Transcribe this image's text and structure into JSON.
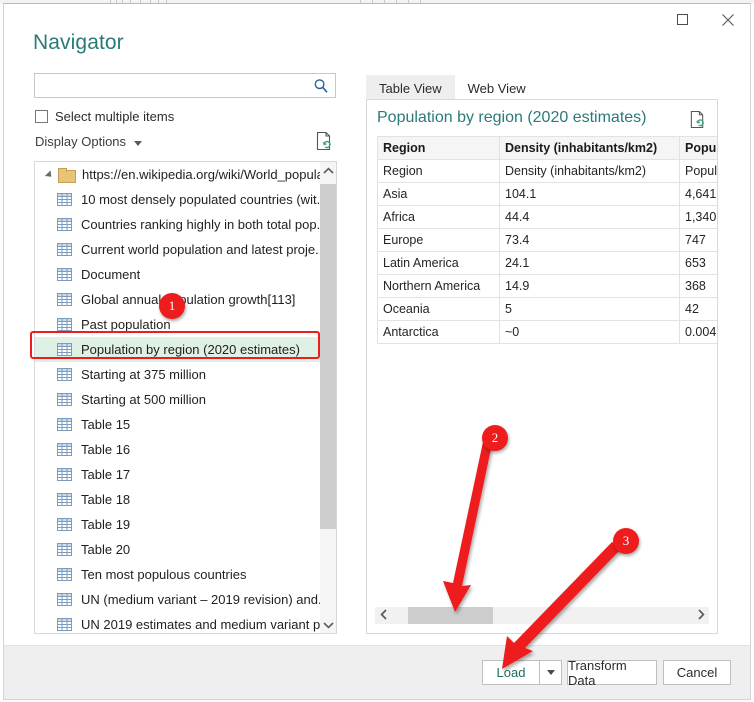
{
  "window": {
    "title": "Navigator",
    "controls": [
      {
        "name": "maximize",
        "glyph": "maximize-icon"
      },
      {
        "name": "close",
        "glyph": "close-icon"
      }
    ]
  },
  "search": {
    "value": "",
    "placeholder": "",
    "icon": "search-icon"
  },
  "options": {
    "select_multiple_label": "Select multiple items",
    "select_multiple_checked": false,
    "display_options_label": "Display Options",
    "display_options_caret": "chevron-down-icon",
    "refresh_icon": "refresh-document-icon"
  },
  "tree": {
    "root": {
      "label": "https://en.wikipedia.org/wiki/World_popula...",
      "icon": "folder-icon",
      "expanded": true
    },
    "items": [
      {
        "label": "10 most densely populated countries (wit...",
        "icon": "table-icon",
        "selected": false
      },
      {
        "label": "Countries ranking highly in both total pop...",
        "icon": "table-icon",
        "selected": false
      },
      {
        "label": "Current world population and latest proje...",
        "icon": "table-icon",
        "selected": false
      },
      {
        "label": "Document",
        "icon": "table-icon",
        "selected": false
      },
      {
        "label": "Global annual population growth[113]",
        "icon": "table-icon",
        "selected": false
      },
      {
        "label": "Past population",
        "icon": "table-icon",
        "selected": false
      },
      {
        "label": "Population by region (2020 estimates)",
        "icon": "table-icon",
        "selected": true
      },
      {
        "label": "Starting at 375 million",
        "icon": "table-icon",
        "selected": false
      },
      {
        "label": "Starting at 500 million",
        "icon": "table-icon",
        "selected": false
      },
      {
        "label": "Table 15",
        "icon": "table-icon",
        "selected": false
      },
      {
        "label": "Table 16",
        "icon": "table-icon",
        "selected": false
      },
      {
        "label": "Table 17",
        "icon": "table-icon",
        "selected": false
      },
      {
        "label": "Table 18",
        "icon": "table-icon",
        "selected": false
      },
      {
        "label": "Table 19",
        "icon": "table-icon",
        "selected": false
      },
      {
        "label": "Table 20",
        "icon": "table-icon",
        "selected": false
      },
      {
        "label": "Ten most populous countries",
        "icon": "table-icon",
        "selected": false
      },
      {
        "label": "UN (medium variant – 2019 revision) and...",
        "icon": "table-icon",
        "selected": false
      },
      {
        "label": "UN 2019 estimates and medium variant p...",
        "icon": "table-icon",
        "selected": false
      }
    ],
    "scrollbar": {
      "up_icon": "chevron-up-icon",
      "down_icon": "chevron-down-icon"
    }
  },
  "preview": {
    "tabs": [
      {
        "label": "Table View",
        "active": true
      },
      {
        "label": "Web View",
        "active": false
      }
    ],
    "title": "Population by region (2020 estimates)",
    "refresh_icon": "refresh-document-icon",
    "table": {
      "headers": [
        "Region",
        "Density (inhabitants/km2)",
        "Population"
      ],
      "rows": [
        [
          "Region",
          "Density (inhabitants/km2)",
          "Population"
        ],
        [
          "Asia",
          "104.1",
          "4,641"
        ],
        [
          "Africa",
          "44.4",
          "1,340"
        ],
        [
          "Europe",
          "73.4",
          "747"
        ],
        [
          "Latin America",
          "24.1",
          "653"
        ],
        [
          "Northern America",
          "14.9",
          "368"
        ],
        [
          "Oceania",
          "5",
          "42"
        ],
        [
          "Antarctica",
          "~0",
          "0.004"
        ]
      ]
    },
    "hscroll": {
      "left_icon": "chevron-left-icon",
      "right_icon": "chevron-right-icon"
    }
  },
  "footer": {
    "load_label": "Load",
    "load_split_icon": "chevron-down-icon",
    "transform_label": "Transform Data",
    "cancel_label": "Cancel"
  },
  "annotations": {
    "badges": [
      {
        "number": "1",
        "target": "selected-tree-item"
      },
      {
        "number": "2",
        "target": "preview-horizontal-scrollbar"
      },
      {
        "number": "3",
        "target": "load-button"
      }
    ],
    "accent_color": "#ee1c1c",
    "selection_color": "#dff0e4",
    "title_color": "#2b7a78"
  }
}
